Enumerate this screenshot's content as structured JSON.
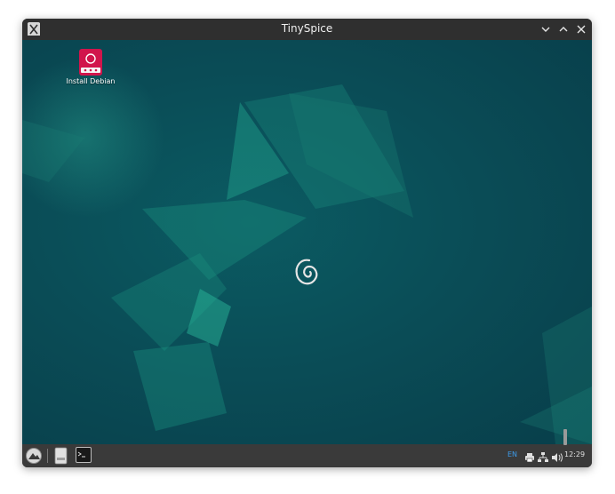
{
  "window": {
    "title": "TinySpice",
    "controls": [
      "minimize-icon",
      "maximize-icon",
      "close-icon"
    ]
  },
  "desktop": {
    "icons": [
      {
        "label": "Install Debian",
        "icon": "debian-installer-icon"
      }
    ],
    "center_logo": "debian-swirl-logo"
  },
  "taskbar": {
    "launcher_icon": "start-menu-icon",
    "items": [
      {
        "icon": "file-manager-icon"
      },
      {
        "icon": "terminal-icon"
      }
    ],
    "tray": {
      "language": "EN",
      "time": "12:29",
      "icons": [
        "printer-icon",
        "network-icon",
        "volume-icon"
      ]
    }
  },
  "colors": {
    "desktop_bg": "#0a4d57",
    "accent_teal": "#1f9f8a",
    "debian_red": "#d1154c",
    "lang_blue": "#3d9be9"
  }
}
